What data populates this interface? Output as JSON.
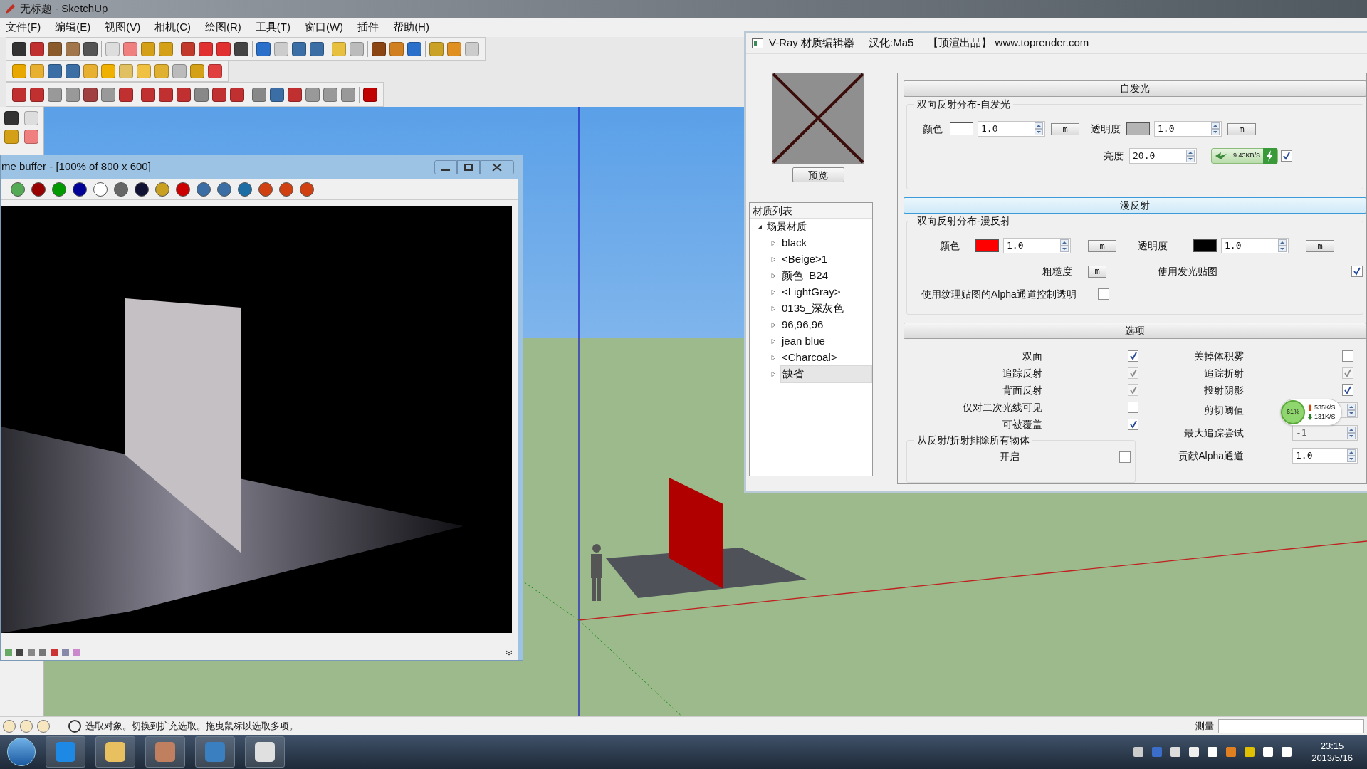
{
  "window": {
    "title": "无标题 - SketchUp"
  },
  "menu": [
    "文件(F)",
    "编辑(E)",
    "视图(V)",
    "相机(C)",
    "绘图(R)",
    "工具(T)",
    "窗口(W)",
    "插件",
    "帮助(H)"
  ],
  "frame_buffer": {
    "title": "me buffer - [100% of 800 x 600]"
  },
  "vray_editor": {
    "title": "V-Ray 材质编辑器",
    "credit": "汉化:Ma5",
    "source": "【顶渲出品】 www.toprender.com",
    "preview_button": "预览",
    "material_list": {
      "header": "材质列表",
      "root": {
        "label": "场景材质",
        "expanded": true,
        "children": [
          {
            "label": "black",
            "selected": false
          },
          {
            "label": "<Beige>1",
            "selected": false
          },
          {
            "label": "颜色_B24",
            "selected": false
          },
          {
            "label": "<LightGray>",
            "selected": false
          },
          {
            "label": "0135_深灰色",
            "selected": false
          },
          {
            "label": "96,96,96",
            "selected": false
          },
          {
            "label": "jean blue",
            "selected": false
          },
          {
            "label": "<Charcoal>",
            "selected": false
          },
          {
            "label": "缺省",
            "selected": true
          }
        ]
      }
    },
    "self_illumination": {
      "header": "自发光",
      "selected": false,
      "group": "双向反射分布-自发光",
      "color": {
        "label": "颜色",
        "color": "#ffffff",
        "value": "1.0",
        "map": "m"
      },
      "transparency": {
        "label": "透明度",
        "color": "#b4b4b4",
        "value": "1.0",
        "map": "m"
      },
      "brightness": {
        "label": "亮度",
        "value": "20.0"
      },
      "enabled": {
        "checked": true
      }
    },
    "diffuse": {
      "header": "漫反射",
      "selected": true,
      "group": "双向反射分布-漫反射",
      "color": {
        "label": "颜色",
        "color": "#ff0000",
        "value": "1.0",
        "map": "m"
      },
      "transparency": {
        "label": "透明度",
        "color": "#000000",
        "value": "1.0",
        "map": "m"
      },
      "roughness": {
        "label": "粗糙度",
        "map": "m"
      },
      "use_illumination_map": {
        "label": "使用发光贴图",
        "checked": true
      },
      "alpha_transparency": {
        "label": "使用纹理贴图的Alpha通道控制透明",
        "checked": false
      }
    },
    "options": {
      "header": "选项",
      "selected": false,
      "left": [
        {
          "kind": "checkbox",
          "label": "双面",
          "checked": true,
          "disabled": false
        },
        {
          "kind": "checkbox",
          "label": "追踪反射",
          "checked": true,
          "disabled": true
        },
        {
          "kind": "checkbox",
          "label": "背面反射",
          "checked": true,
          "disabled": true
        },
        {
          "kind": "checkbox",
          "label": "仅对二次光线可见",
          "checked": false,
          "disabled": false
        },
        {
          "kind": "checkbox",
          "label": "可被覆盖",
          "checked": true,
          "disabled": false
        }
      ],
      "right": [
        {
          "kind": "checkbox",
          "label": "关掉体积雾",
          "checked": false,
          "disabled": false
        },
        {
          "kind": "checkbox",
          "label": "追踪折射",
          "checked": true,
          "disabled": true
        },
        {
          "kind": "checkbox",
          "label": "投射阴影",
          "checked": true,
          "disabled": false
        },
        {
          "kind": "spinner",
          "label": "剪切阈值",
          "disabled": true
        },
        {
          "kind": "spinner",
          "label": "最大追踪尝试",
          "value": "-1",
          "disabled": true
        },
        {
          "kind": "spinner",
          "label": "贡献Alpha通道",
          "value": "1.0",
          "disabled": false
        }
      ],
      "exclude_group": {
        "label": "从反射/折射排除所有物体",
        "option": {
          "label": "开启",
          "checked": false
        }
      }
    }
  },
  "speed_widget": {
    "speed": "9.43KB/S"
  },
  "network_widget": {
    "percent": "61%",
    "upload": "535K/S",
    "download": "131K/S"
  },
  "status_bar": {
    "message": "选取对象。切换到扩充选取。拖曳鼠标以选取多项。",
    "measure_label": "测量"
  },
  "taskbar": {
    "time": "23:15",
    "date": "2013/5/16"
  }
}
